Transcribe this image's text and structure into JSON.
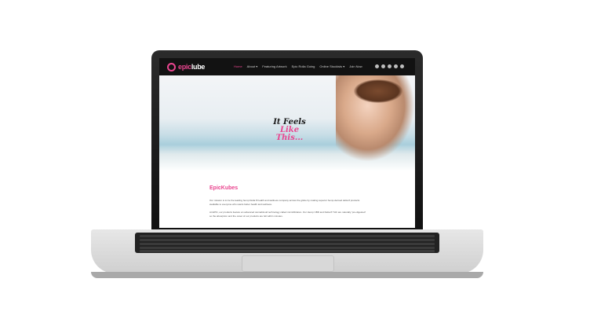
{
  "brand": {
    "logo_prefix": "epic",
    "logo_suffix": "lube",
    "accent_color": "#e9458f"
  },
  "nav": {
    "items": [
      {
        "label": "Home"
      },
      {
        "label": "About ▾"
      },
      {
        "label": "Featuring Artwork"
      },
      {
        "label": "Epic Rolla Going"
      },
      {
        "label": "Online Stockists ▾"
      },
      {
        "label": "Join Now"
      }
    ],
    "socials": [
      "instagram-icon",
      "pinterest-icon",
      "twitter-icon",
      "tiktok-icon",
      "youtube-icon"
    ]
  },
  "hero": {
    "tagline_line1": "It Feels",
    "tagline_line2": "Like This..."
  },
  "content": {
    "heading": "EpicKubes",
    "paragraph1": "Our mission is to be the leading hemp Delta 8 health and wellness company across the globe by making superior hemp-derived delta 8 products available to everyone who wants better health and wellness.",
    "paragraph2": "At EPIC, our products feature an advanced cannabinoid technology called microfilization. Our Hemp CBD and Delta 8 THC are naturally 'pre-digested' so the absorption and the onset of our products are felt within minutes."
  }
}
